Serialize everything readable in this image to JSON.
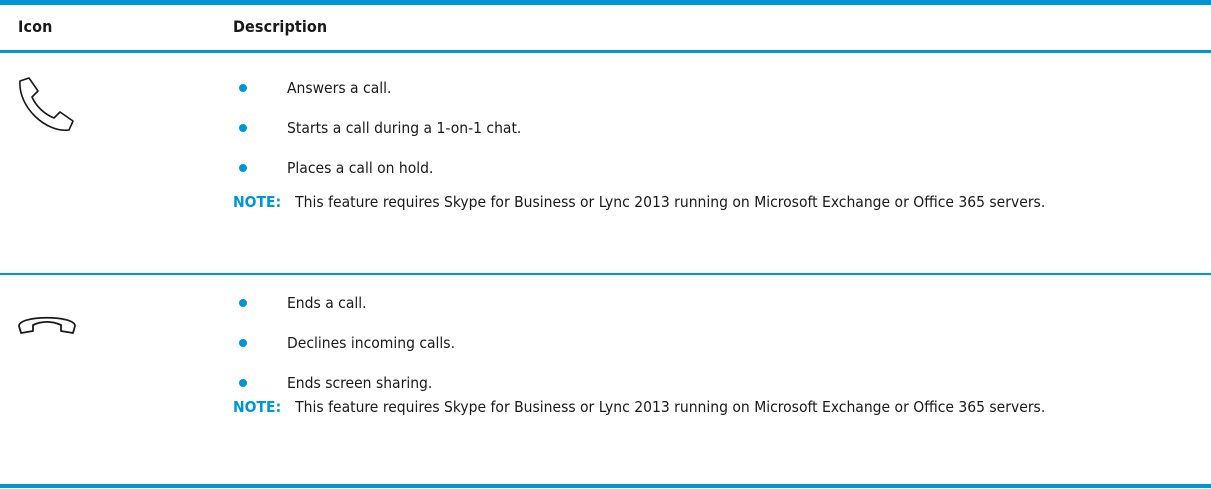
{
  "table": {
    "header": {
      "icon": "Icon",
      "description": "Description"
    },
    "rows": [
      {
        "icon": "phone-answer-icon",
        "bullets": [
          "Answers a call.",
          "Starts a call during a 1-on-1 chat.",
          "Places a call on hold."
        ],
        "note_label": "NOTE:",
        "note_text": "This feature requires Skype for Business or Lync 2013 running on Microsoft Exchange or Office 365 servers."
      },
      {
        "icon": "phone-hangup-icon",
        "bullets": [
          "Ends a call.",
          "Declines incoming calls.",
          "Ends screen sharing."
        ],
        "note_label": "NOTE:",
        "note_text": "This feature requires Skype for Business or Lync 2013 running on Microsoft Exchange or Office 365 servers."
      }
    ]
  },
  "colors": {
    "accent": "#0096d6",
    "text": "#1a1a1a"
  }
}
